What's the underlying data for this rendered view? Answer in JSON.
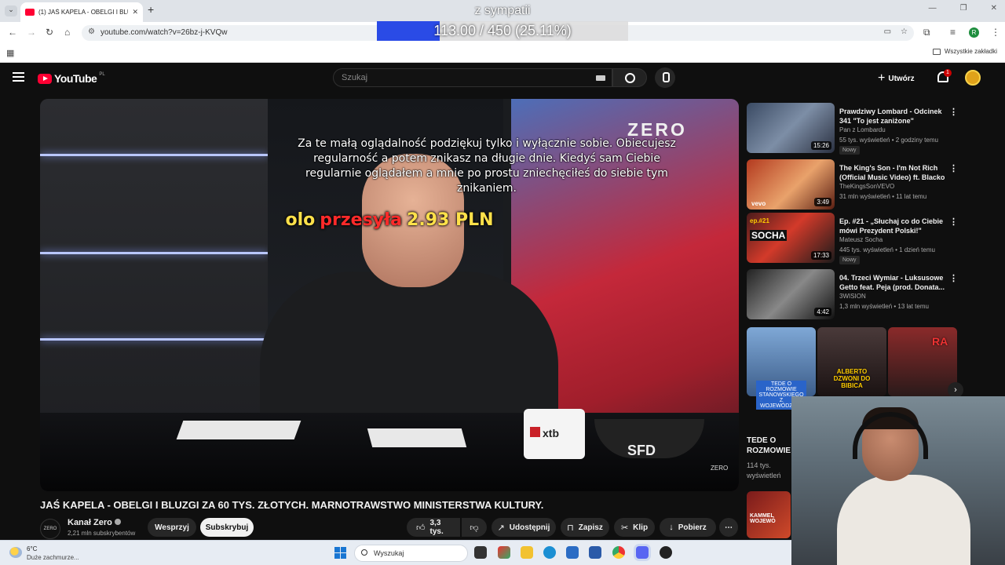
{
  "browser": {
    "tab_title": "(1) JAŚ KAPELA - OBELGI I BLUZ",
    "url": "youtube.com/watch?v=26bz-j-KVQw",
    "all_bookmarks": "Wszystkie zakładki",
    "profile_letter": "R"
  },
  "overlay": {
    "goal_title": "z sympatii",
    "goal_text": "113.00 / 450 (25.11%)",
    "goal_progress": 0.2511,
    "donor": "olo",
    "verb": "przesyła",
    "amount": "2.93 PLN",
    "message": "Za te małą oglądalność podziękuj tylko i wyłącznie sobie. Obiecujesz regularność a potem znikasz na długie dnie. Kiedyś sam Ciebie regularnie oglądałem a mnie po prostu zniechęciłeś do siebie tym znikaniem."
  },
  "youtube": {
    "logo": "YouTube",
    "region": "PL",
    "search_placeholder": "Szukaj",
    "create_label": "Utwórz",
    "notif_count": "1"
  },
  "video": {
    "brand_logo": "ZERO",
    "mug_label": "xtb",
    "bowl_label": "SFD",
    "corner_logo": "ZERO",
    "title": "JAŚ KAPELA - OBELGI I BLUZGI ZA 60 TYS. ZŁOTYCH. MARNOTRAWSTWO MINISTERSTWA KULTURY.",
    "channel": "Kanał Zero",
    "channel_logo": "ZERO",
    "subscribers": "2,21 mln subskrybentów",
    "support": "Wesprzyj",
    "subscribe": "Subskrybuj",
    "likes": "3,3 tys.",
    "share": "Udostępnij",
    "save": "Zapisz",
    "clip": "Klip",
    "download": "Pobierz"
  },
  "sidebar": {
    "items": [
      {
        "title": "Prawdziwy Lombard - Odcinek 341 \"To jest zaniżone\"",
        "channel": "Pan z Lombardu",
        "meta": "55 tys. wyświetleń • 2 godziny temu",
        "badge": "Nowy",
        "duration": "15:26"
      },
      {
        "title": "The King's Son - I'm Not Rich (Official Music Video) ft. Blacko",
        "channel": "TheKingsSonVEVO",
        "meta": "31 mln wyświetleń • 11 lat temu",
        "duration": "3:49",
        "thumb_text": "vevo"
      },
      {
        "title": "Ep. #21 - „Słuchaj co do Ciebie mówi Prezydent Polski!\"",
        "channel": "Mateusz Socha",
        "meta": "445 tys. wyświetleń • 1 dzień temu",
        "badge": "Nowy",
        "duration": "17:33",
        "thumb_top": "ep.#21",
        "thumb_text": "SOCHA"
      },
      {
        "title": "04. Trzeci Wymiar - Luksusowe Getto feat. Peja (prod. Donata...",
        "channel": "3WISION",
        "meta": "1,3 mln wyświetleń • 13 lat temu",
        "duration": "4:42"
      }
    ],
    "shorts": [
      {
        "overlay": "TEDE O ROZMOWIE STANOWSKIEGO Z WOJEWÓDZKIM"
      },
      {
        "overlay": "ALBERTO DZWONI DO BIBICA"
      },
      {
        "overlay": "RA"
      }
    ],
    "short_title": "TEDE O ROZMOWIE",
    "short_views": "114 tys. wyświetleń",
    "bottom_thumb_text": "KAMMEL WOJEWÓ"
  },
  "taskbar": {
    "temp": "6°C",
    "weather": "Duże zachmurze...",
    "search": "Wyszukaj"
  }
}
